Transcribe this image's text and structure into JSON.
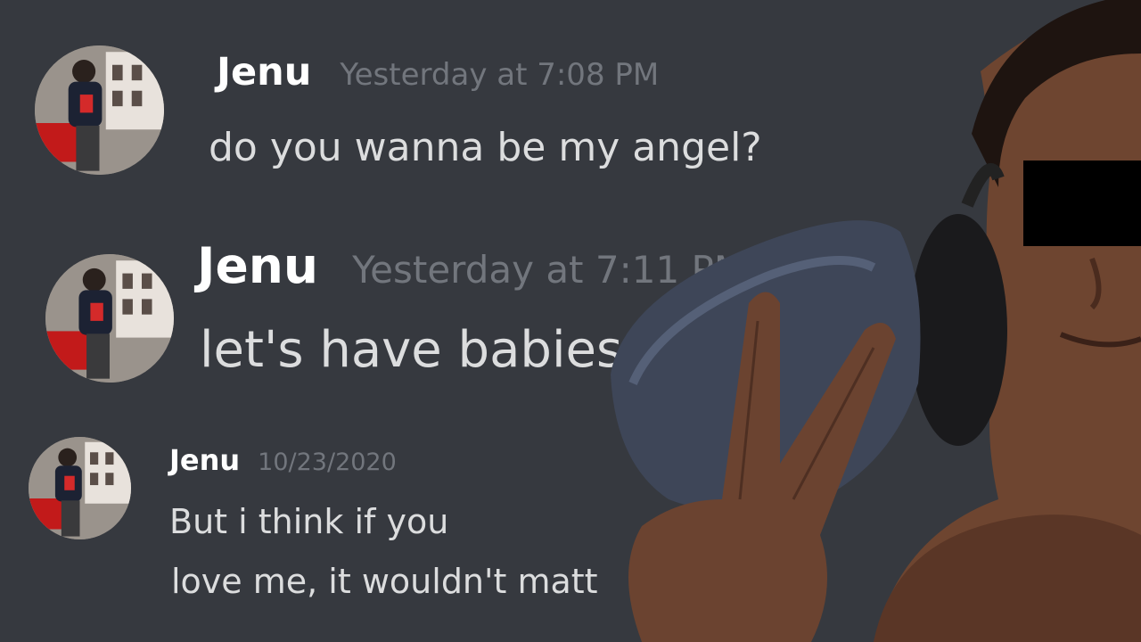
{
  "messages": [
    {
      "author": "Jenu",
      "timestamp": "Yesterday at 7:08 PM",
      "lines": [
        "do you wanna be my angel?"
      ]
    },
    {
      "author": "Jenu",
      "timestamp": "Yesterday at 7:11 PM",
      "lines": [
        "let's have babies"
      ]
    },
    {
      "author": "Jenu",
      "timestamp": "10/23/2020",
      "lines": [
        "But i think if you",
        "love me, it wouldn't matt"
      ]
    }
  ],
  "colors": {
    "background": "#36393f",
    "author": "#ffffff",
    "timestamp": "#72767d",
    "message_text": "#dcddde"
  }
}
